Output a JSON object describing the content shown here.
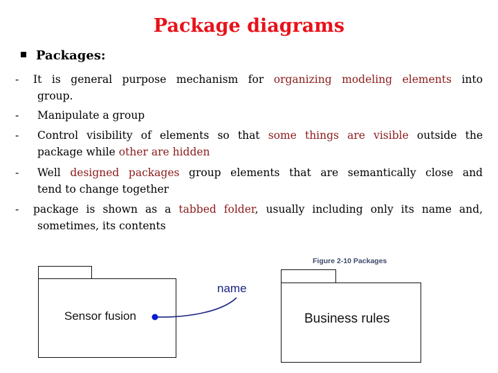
{
  "title": "Package diagrams",
  "heading": "Packages:",
  "bullets": [
    {
      "dash": "-",
      "line1": [
        "It is general purpose mechanism for ",
        {
          "hl": "organizing modeling elements"
        },
        " into"
      ],
      "line2": "group."
    },
    {
      "dash": "-",
      "line1": [
        "Manipulate a group"
      ]
    },
    {
      "dash": "-",
      "line1": [
        "Control visibility of elements so that ",
        {
          "hl": "some things are visible"
        },
        " outside the"
      ],
      "line2_parts": [
        "package while ",
        {
          "hl": "other are hidden"
        }
      ]
    },
    {
      "dash": "-",
      "line1": [
        "Well ",
        {
          "hl": "designed packages"
        },
        " group elements that are semantically close and"
      ],
      "line2": "tend to change together"
    },
    {
      "dash": "-",
      "line1": [
        "package is shown as a ",
        {
          "hl": "tabbed folder"
        },
        ", usually including only its name and,"
      ],
      "line2": "sometimes, its contents"
    }
  ],
  "text": {
    "b0_l1_a": "It is general purpose mechanism for",
    "b0_l1_hl": "organizing modeling elements",
    "b0_l1_b": "into",
    "b0_l2": "group.",
    "b1_l1": "Manipulate a group",
    "b2_l1_a": "Control visibility of elements so that",
    "b2_l1_hl": "some things are visible",
    "b2_l1_b": "outside the",
    "b2_l2_a": "package while",
    "b2_l2_hl": "other are hidden",
    "b3_l1_a": "Well",
    "b3_l1_hl": "designed packages",
    "b3_l1_b": "group elements that are semantically close and",
    "b3_l2": "tend to change together",
    "b4_l1_a": "package is shown as a",
    "b4_l1_hl": "tabbed folder",
    "b4_l1_b": ", usually including only its name and,",
    "b4_l2": "sometimes, its contents",
    "dash": "-"
  },
  "figure_left": {
    "package_name": "Sensor fusion",
    "annotation": "name",
    "annotation_color": "#1a237e",
    "dot_color": "#0a1ad6"
  },
  "figure_right": {
    "caption": "Figure 2-10 Packages",
    "package_name": "Business rules"
  },
  "colors": {
    "title": "#e8121a",
    "highlight": "#8b1a1a"
  }
}
